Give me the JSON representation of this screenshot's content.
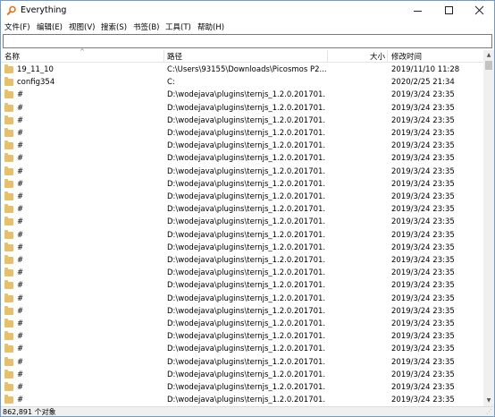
{
  "window": {
    "title": "Everything"
  },
  "menu": [
    "文件(F)",
    "编辑(E)",
    "视图(V)",
    "搜索(S)",
    "书签(B)",
    "工具(T)",
    "帮助(H)"
  ],
  "search": {
    "value": ""
  },
  "columns": {
    "name": "名称",
    "path": "路径",
    "size": "大小",
    "modified": "修改时间"
  },
  "rows": [
    {
      "name": "19_11_10",
      "path": "C:\\Users\\93155\\Downloads\\Picosmos P2...",
      "modified": "2019/11/10 11:28"
    },
    {
      "name": "config354",
      "path": "C:",
      "modified": "2020/2/25 21:34"
    },
    {
      "name": "#",
      "path": "D:\\wodejava\\plugins\\ternjs_1.2.0.201701...",
      "modified": "2019/3/24 23:35"
    },
    {
      "name": "#",
      "path": "D:\\wodejava\\plugins\\ternjs_1.2.0.201701...",
      "modified": "2019/3/24 23:35"
    },
    {
      "name": "#",
      "path": "D:\\wodejava\\plugins\\ternjs_1.2.0.201701...",
      "modified": "2019/3/24 23:35"
    },
    {
      "name": "#",
      "path": "D:\\wodejava\\plugins\\ternjs_1.2.0.201701...",
      "modified": "2019/3/24 23:35"
    },
    {
      "name": "#",
      "path": "D:\\wodejava\\plugins\\ternjs_1.2.0.201701...",
      "modified": "2019/3/24 23:35"
    },
    {
      "name": "#",
      "path": "D:\\wodejava\\plugins\\ternjs_1.2.0.201701...",
      "modified": "2019/3/24 23:35"
    },
    {
      "name": "#",
      "path": "D:\\wodejava\\plugins\\ternjs_1.2.0.201701...",
      "modified": "2019/3/24 23:35"
    },
    {
      "name": "#",
      "path": "D:\\wodejava\\plugins\\ternjs_1.2.0.201701...",
      "modified": "2019/3/24 23:35"
    },
    {
      "name": "#",
      "path": "D:\\wodejava\\plugins\\ternjs_1.2.0.201701...",
      "modified": "2019/3/24 23:35"
    },
    {
      "name": "#",
      "path": "D:\\wodejava\\plugins\\ternjs_1.2.0.201701...",
      "modified": "2019/3/24 23:35"
    },
    {
      "name": "#",
      "path": "D:\\wodejava\\plugins\\ternjs_1.2.0.201701...",
      "modified": "2019/3/24 23:35"
    },
    {
      "name": "#",
      "path": "D:\\wodejava\\plugins\\ternjs_1.2.0.201701...",
      "modified": "2019/3/24 23:35"
    },
    {
      "name": "#",
      "path": "D:\\wodejava\\plugins\\ternjs_1.2.0.201701...",
      "modified": "2019/3/24 23:35"
    },
    {
      "name": "#",
      "path": "D:\\wodejava\\plugins\\ternjs_1.2.0.201701...",
      "modified": "2019/3/24 23:35"
    },
    {
      "name": "#",
      "path": "D:\\wodejava\\plugins\\ternjs_1.2.0.201701...",
      "modified": "2019/3/24 23:35"
    },
    {
      "name": "#",
      "path": "D:\\wodejava\\plugins\\ternjs_1.2.0.201701...",
      "modified": "2019/3/24 23:35"
    },
    {
      "name": "#",
      "path": "D:\\wodejava\\plugins\\ternjs_1.2.0.201701...",
      "modified": "2019/3/24 23:35"
    },
    {
      "name": "#",
      "path": "D:\\wodejava\\plugins\\ternjs_1.2.0.201701...",
      "modified": "2019/3/24 23:35"
    },
    {
      "name": "#",
      "path": "D:\\wodejava\\plugins\\ternjs_1.2.0.201701...",
      "modified": "2019/3/24 23:35"
    },
    {
      "name": "#",
      "path": "D:\\wodejava\\plugins\\ternjs_1.2.0.201701...",
      "modified": "2019/3/24 23:35"
    },
    {
      "name": "#",
      "path": "D:\\wodejava\\plugins\\ternjs_1.2.0.201701...",
      "modified": "2019/3/24 23:35"
    },
    {
      "name": "#",
      "path": "D:\\wodejava\\plugins\\ternjs_1.2.0.201701...",
      "modified": "2019/3/24 23:35"
    },
    {
      "name": "#",
      "path": "D:\\wodejava\\plugins\\ternjs_1.2.0.201701...",
      "modified": "2019/3/24 23:35"
    },
    {
      "name": "#",
      "path": "D:\\wodejava\\plugins\\ternjs_1.2.0.201701...",
      "modified": "2019/3/24 23:35"
    },
    {
      "name": "#",
      "path": "D:\\wodejava\\plugins\\ternjs_1.2.0.201701...",
      "modified": "2019/3/24 23:35"
    }
  ],
  "status": {
    "text": "862,891 个对象"
  },
  "colors": {
    "folder": "#e8c06a",
    "icon_orange": "#e8731b",
    "border": "#6e9bd1"
  },
  "icons": {
    "app": "magnifier-icon",
    "folder": "folder-icon"
  }
}
